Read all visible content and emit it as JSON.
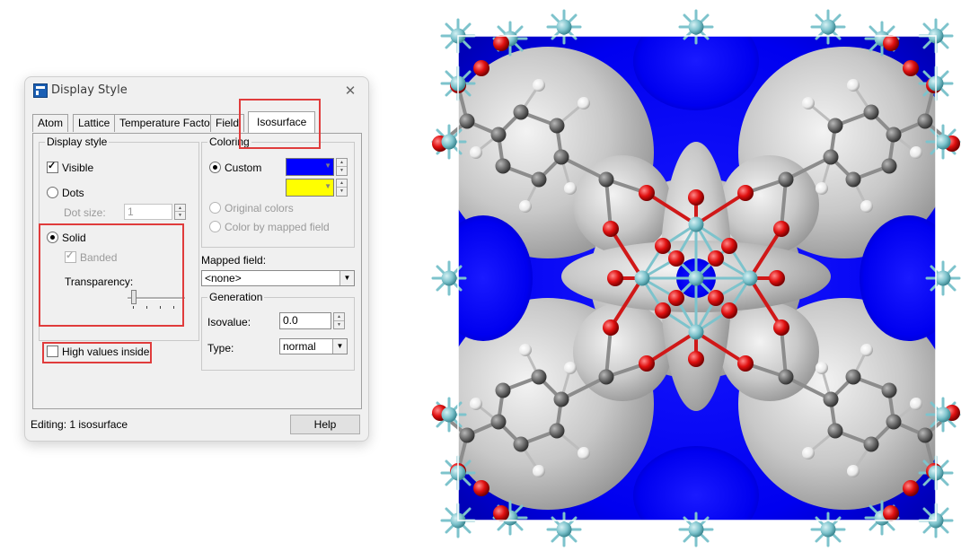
{
  "dialog": {
    "title": "Display Style",
    "close_glyph": "✕",
    "tabs": [
      {
        "label": "Atom"
      },
      {
        "label": "Lattice"
      },
      {
        "label": "Temperature Factor"
      },
      {
        "label": "Field"
      },
      {
        "label": "Isosurface",
        "active": true
      }
    ],
    "display_style": {
      "legend": "Display style",
      "visible_label": "Visible",
      "visible_checked": true,
      "dots_label": "Dots",
      "dot_size_label": "Dot size:",
      "dot_size_value": "1",
      "solid_label": "Solid",
      "solid_selected": true,
      "banded_label": "Banded",
      "banded_checked": true,
      "transparency_label": "Transparency:",
      "transparency_level": 0
    },
    "high_values_label": "High values inside",
    "high_values_checked": false,
    "coloring": {
      "legend": "Coloring",
      "custom_label": "Custom",
      "custom_selected": true,
      "color_1": "#0000ff",
      "color_2": "#ffff00",
      "original_colors_label": "Original colors",
      "mapped_field_color_label": "Color by mapped field"
    },
    "mapped_field": {
      "label": "Mapped field:",
      "value": "<none>"
    },
    "generation": {
      "legend": "Generation",
      "isovalue_label": "Isovalue:",
      "isovalue": "0.0",
      "type_label": "Type:",
      "type_value": "normal"
    },
    "status": "Editing: 1 isosurface",
    "help_label": "Help"
  },
  "highlight_color": "#e03c3c",
  "viewer": {
    "isosurface_color": "#0000ff",
    "surface_color": "#c8c8c8",
    "atom_colors": {
      "carbon": "#6f6f6f",
      "oxygen": "#e01010",
      "hydrogen": "#f2f2f2",
      "metal": "#7dc3cc"
    }
  }
}
